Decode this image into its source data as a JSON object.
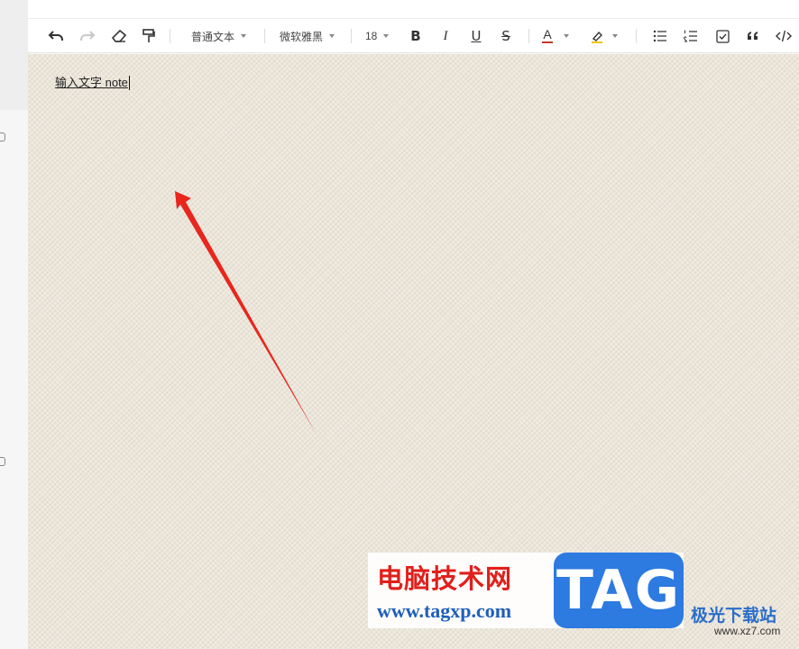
{
  "toolbar": {
    "paragraph_style": "普通文本",
    "font_family": "微软雅黑",
    "font_size": "18",
    "bold_label": "B",
    "italic_label": "I",
    "underline_label": "U",
    "strike_label": "S",
    "font_color_label": "A",
    "font_color": "#c0392b",
    "highlight_color": "#f2c300"
  },
  "editor": {
    "content": "输入文字 note"
  },
  "annotation": {
    "arrow_color": "#e8261d"
  },
  "watermark": {
    "site_name": "电脑技术网",
    "site_url": "www.tagxp.com",
    "badge": "TAG",
    "side_title": "极光下载站",
    "side_url": "www.xz7.com"
  }
}
